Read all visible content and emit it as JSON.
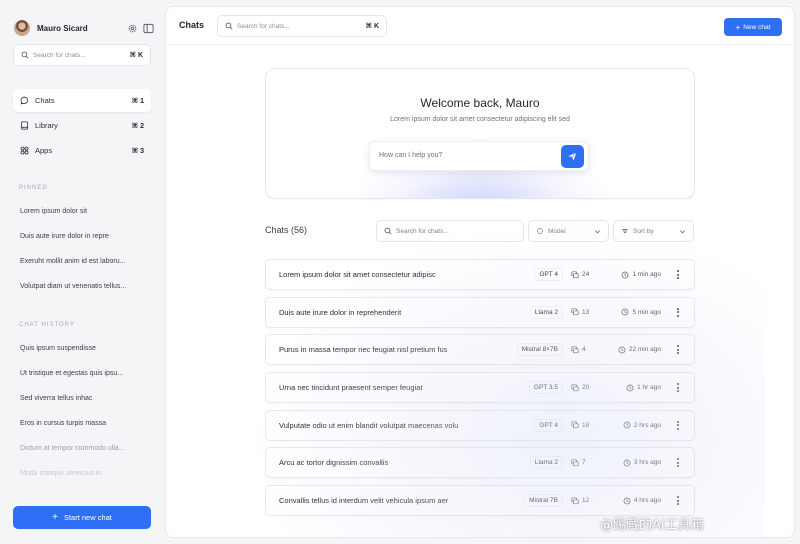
{
  "sidebar": {
    "profile_name": "Mauro Sicard",
    "search_placeholder": "Search for chats...",
    "search_shortcut": "⌘ K",
    "nav": [
      {
        "label": "Chats",
        "shortcut": "⌘ 1",
        "icon": "chat-bubble-icon",
        "active": true
      },
      {
        "label": "Library",
        "shortcut": "⌘ 2",
        "icon": "book-icon",
        "active": false
      },
      {
        "label": "Apps",
        "shortcut": "⌘ 3",
        "icon": "apps-grid-icon",
        "active": false
      }
    ],
    "pinned_label": "PINNED",
    "pinned": [
      "Lorem ipsum dolor sit",
      "Duis aute irure dolor in repre",
      "Exeruht mollit anim id est laboru...",
      "Volutpat diam ut venenatis tellus..."
    ],
    "history_label": "CHAT HISTORY",
    "history": [
      "Quis ipsum suspendisse",
      "Ut tristique et egestas quis ipsu...",
      "Sed viverra tellus inhac",
      "Eros in cursus turpis massa",
      "Dictum at tempor commodo ulla...",
      "Morbi tristique senectus in"
    ],
    "new_chat_label": "Start new chat"
  },
  "topbar": {
    "title": "Chats",
    "search_placeholder": "Search for chats...",
    "search_shortcut": "⌘ K",
    "new_chat_label": "New chat"
  },
  "welcome": {
    "title": "Welcome back, Mauro",
    "subtitle": "Lorem ipsum dolor sit amet consectetur adipiscing elit sed",
    "input_placeholder": "How can I help you?"
  },
  "chats": {
    "heading": "Chats (56)",
    "search_placeholder": "Search for chats...",
    "model_filter": "Model",
    "sort_filter": "Sort by",
    "rows": [
      {
        "title": "Lorem ipsum dolor sit amet consectetur adipisc",
        "model": "GPT 4",
        "count": "24",
        "time": "1 min ago"
      },
      {
        "title": "Duis aute irure dolor in reprehenderit",
        "model": "Llama 2",
        "count": "13",
        "time": "5 min ago"
      },
      {
        "title": "Purus in massa tempor nec feugiat nisl pretium fus",
        "model": "Mistral 8×7B",
        "count": "4",
        "time": "22 min ago"
      },
      {
        "title": "Urna nec tincidunt praesent semper feugiat",
        "model": "GPT 3.5",
        "count": "20",
        "time": "1 hr ago"
      },
      {
        "title": "Vulputate odio ut enim blandit volutpat maecenas volu",
        "model": "GPT 4",
        "count": "18",
        "time": "2 hrs ago"
      },
      {
        "title": "Arcu ac tortor dignissim convallis",
        "model": "Llama 2",
        "count": "7",
        "time": "3 hrs ago"
      },
      {
        "title": "Convallis tellus id interdum velit vehicula ipsum aer",
        "model": "Mistral 7B",
        "count": "12",
        "time": "4 hrs ago"
      }
    ]
  },
  "watermark": "@踢藏的AI工具箱"
}
